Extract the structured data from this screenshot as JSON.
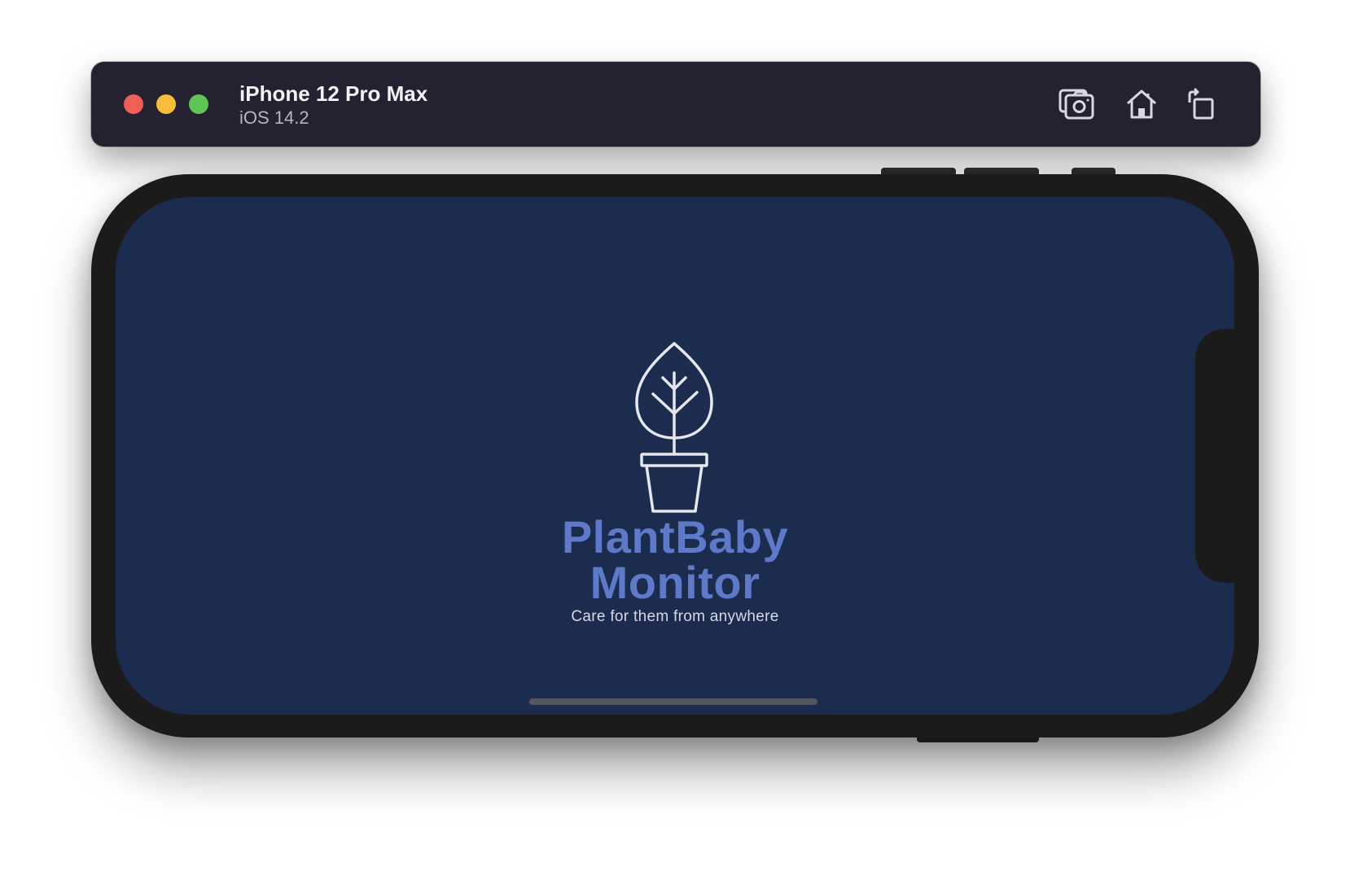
{
  "window": {
    "device_name": "iPhone 12 Pro Max",
    "os_version": "iOS 14.2",
    "controls": {
      "close_color": "#ee5f57",
      "minimize_color": "#f6bd3b",
      "maximize_color": "#5fc454"
    },
    "toolbar": {
      "icons": [
        "camera-icon",
        "home-icon",
        "rotate-icon"
      ]
    }
  },
  "app": {
    "title_line1": "PlantBaby",
    "title_line2": "Monitor",
    "tagline": "Care for them from anywhere",
    "logo_icon": "potted-plant-icon",
    "background_color": "#1b2c4f",
    "title_color": "#5d79c7"
  }
}
